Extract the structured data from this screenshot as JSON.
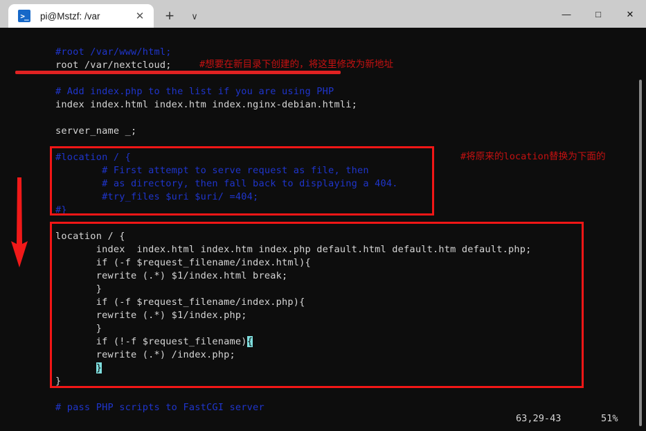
{
  "window": {
    "minimize_label": "—",
    "maximize_label": "□",
    "close_label": "✕"
  },
  "tabstrip": {
    "tab_title": "pi@Mstzf: /var",
    "tab_icon": ">_",
    "tab_close_label": "✕",
    "new_tab_label": "+",
    "dropdown_label": "∨"
  },
  "terminal": {
    "lines": [
      {
        "text": "#root /var/www/html;",
        "color": "comment"
      },
      {
        "text": "root /var/nextcloud;",
        "color": "code"
      },
      {
        "text": "# Add index.php to the list if you are using PHP",
        "color": "comment"
      },
      {
        "text": "index index.html index.htm index.nginx-debian.htmli;",
        "color": "code"
      },
      {
        "text": "server_name _;",
        "color": "code"
      },
      {
        "text": "#location / {",
        "color": "comment"
      },
      {
        "text": "        # First attempt to serve request as file, then",
        "color": "comment"
      },
      {
        "text": "        # as directory, then fall back to displaying a 404.",
        "color": "comment"
      },
      {
        "text": "        #try_files $uri $uri/ =404;",
        "color": "comment"
      },
      {
        "text": "#}",
        "color": "comment"
      },
      {
        "text": "location / {",
        "color": "code"
      },
      {
        "text": "       index  index.html index.htm index.php default.html default.htm default.php;",
        "color": "code"
      },
      {
        "text": "       if (-f $request_filename/index.html){",
        "color": "code"
      },
      {
        "text": "       rewrite (.*) $1/index.html break;",
        "color": "code"
      },
      {
        "text": "       }",
        "color": "code"
      },
      {
        "text": "       if (-f $request_filename/index.php){",
        "color": "code"
      },
      {
        "text": "       rewrite (.*) $1/index.php;",
        "color": "code"
      },
      {
        "text": "       }",
        "color": "code"
      },
      {
        "text": "       if (!-f $request_filename)",
        "color": "code",
        "highlight": "{"
      },
      {
        "text": "       rewrite (.*) /index.php;",
        "color": "code"
      },
      {
        "text": "       ",
        "color": "code",
        "highlight": "}"
      },
      {
        "text": "}",
        "color": "code"
      },
      {
        "text": "# pass PHP scripts to FastCGI server",
        "color": "comment"
      }
    ],
    "status_position": "63,29-43",
    "status_percent": "51%"
  },
  "annotations": {
    "note_root": "#想要在新目录下创建的，将这里修改为新地址",
    "note_location": "#将原来的location替换为下面的"
  },
  "colors": {
    "terminal_background": "#0d0d0d",
    "comment": "#1f35cc",
    "code": "#d6d6d6",
    "annotation_red": "#c51111",
    "box_red": "#f21616",
    "underline_red": "#e02222",
    "match_highlight": "#7fdede",
    "titlebar": "#cccccc",
    "tab_active": "#ffffff",
    "tab_icon": "#1668c8"
  }
}
